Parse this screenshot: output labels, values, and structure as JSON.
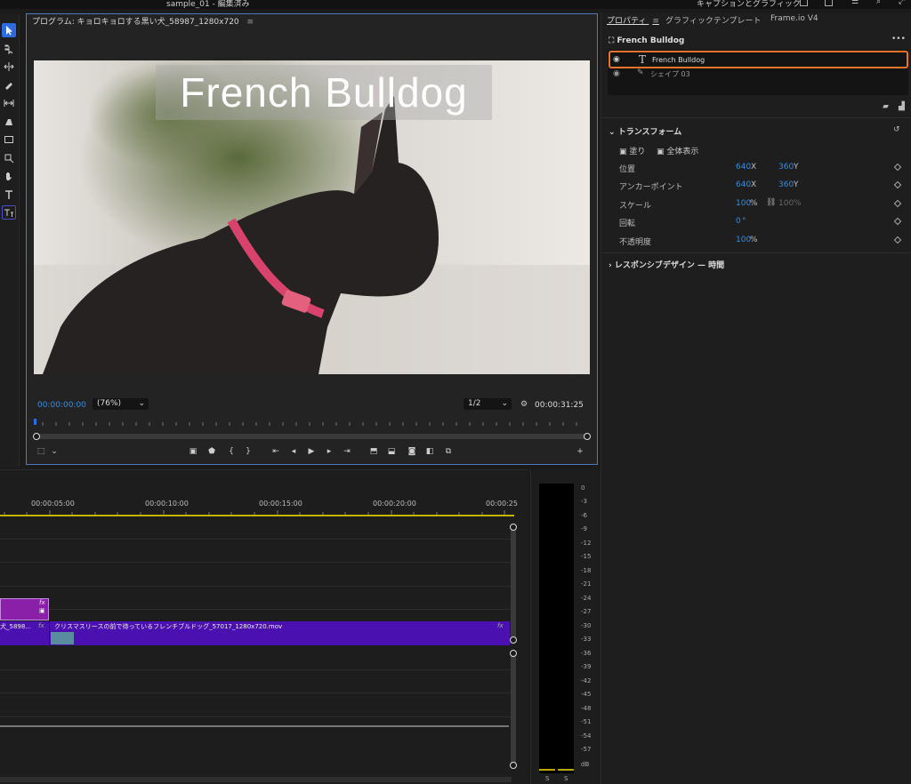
{
  "window": {
    "title": "sample_01 - 編集済み",
    "workspace": "キャプションとグラフィック"
  },
  "program_monitor": {
    "title": "プログラム: キョロキョロする黒い犬_58987_1280x720",
    "video_text": "French Bulldog",
    "timecode": "00:00:00:00",
    "zoom": "(76%)",
    "resolution": "1/2",
    "duration": "00:00:31:25"
  },
  "properties": {
    "tabs": [
      "プロパティ",
      "グラフィックテンプレート",
      "Frame.io V4"
    ],
    "selected_name": "French Bulldog",
    "layers": [
      {
        "name": "French Bulldog",
        "type": "text"
      },
      {
        "name": "シェイプ 03",
        "type": "shape"
      }
    ],
    "transform": {
      "header": "トランスフォーム",
      "fill_label": "塗り",
      "show_all_label": "全体表示",
      "position_label": "位置",
      "position_x": "640",
      "position_y": "360",
      "anchor_label": "アンカーポイント",
      "anchor_x": "640",
      "anchor_y": "360",
      "scale_label": "スケール",
      "scale_value": "100",
      "scale_value2": "100",
      "rotation_label": "回転",
      "rotation_value": "0",
      "opacity_label": "不透明度",
      "opacity_value": "100",
      "x_unit": "X",
      "y_unit": "Y",
      "pct": "%",
      "deg": "°"
    },
    "responsive_header": "レスポンシブデザイン — 時間"
  },
  "timeline": {
    "ruler": [
      "00:00:05:00",
      "00:00:10:00",
      "00:00:15:00",
      "00:00:20:00",
      "00:00:25"
    ],
    "clip_left": "犬_5898...",
    "clip_main": "クリスマスリースの前で待っているフレンチブルドッグ_57017_1280x720.mov",
    "fx": "fx"
  },
  "audio_meter": {
    "scale": [
      "0",
      "-3",
      "-6",
      "-9",
      "-12",
      "-15",
      "-18",
      "-21",
      "-24",
      "-27",
      "-30",
      "-33",
      "-36",
      "-39",
      "-42",
      "-45",
      "-48",
      "-51",
      "-54",
      "-57",
      "dB"
    ],
    "channels": [
      "S",
      "S"
    ]
  },
  "colors": {
    "accent": "#2d6be0",
    "selection": "#e8742a",
    "clip_purple": "#4a10b0",
    "clip_magenta": "#8a1fa8",
    "value_blue": "#2f8fe6"
  }
}
